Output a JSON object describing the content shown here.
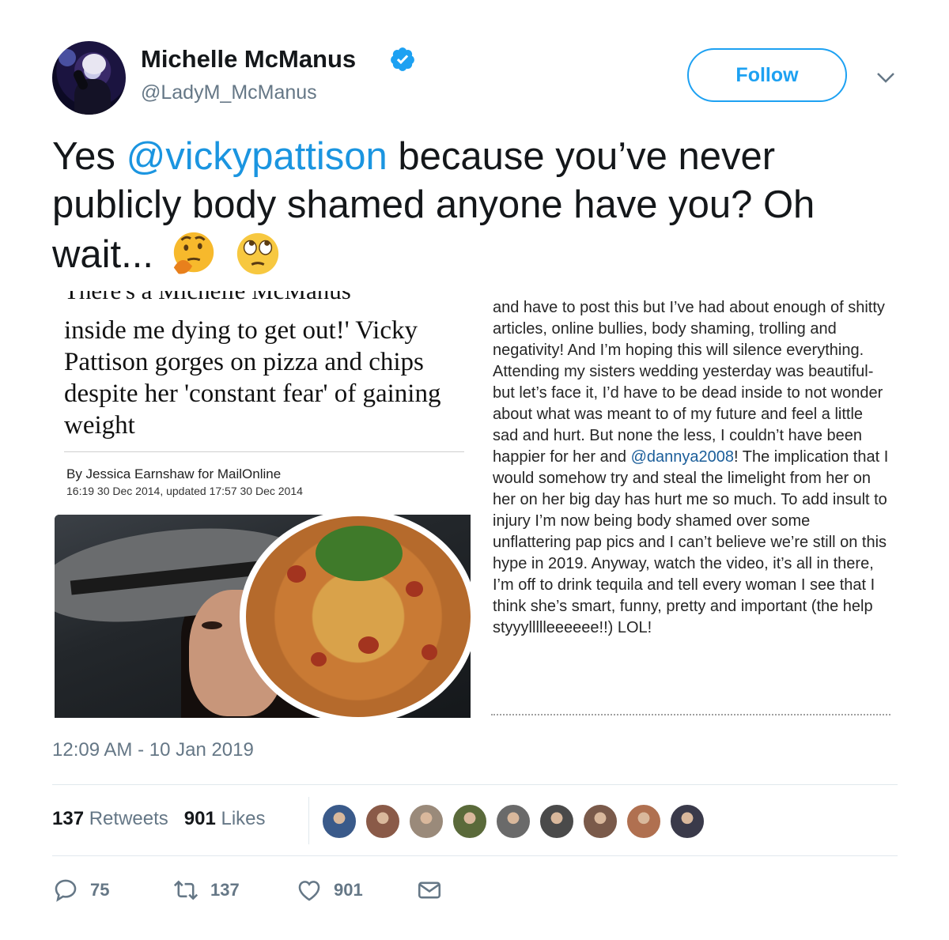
{
  "user": {
    "name": "Michelle McManus",
    "handle": "@LadyM_McManus",
    "verified": true
  },
  "follow_label": "Follow",
  "tweet": {
    "text_start": "Yes ",
    "mention": "@vickypattison",
    "text_rest": " because you’ve never publicly body shamed anyone have you? Oh wait...",
    "emojis": [
      "thinking-face-emoji",
      "face-with-rolling-eyes-emoji"
    ]
  },
  "article": {
    "cut_title": "There's a Michelle McManus",
    "title": "inside me dying to get out!' Vicky Pattison gorges on pizza and chips despite her 'constant fear' of gaining weight",
    "byline": "By Jessica Earnshaw for MailOnline",
    "timeline": "16:19 30 Dec 2014, updated 17:57 30 Dec 2014"
  },
  "caption": {
    "p1": "and have to post this but I’ve had about enough of shitty articles, online bullies, body shaming, trolling and negativity! And I’m hoping this will silence everything.",
    "p2_a": "Attending my sisters wedding yesterday was beautiful- but let’s face it, I’d have to be dead inside to not wonder about what was meant to of my future and feel a little sad and hurt. But none the less, I couldn’t have been happier for her and ",
    "p2_tag": "@dannya2008",
    "p2_b": "! The implication that I would somehow try and steal the limelight from her on her on her big day has hurt me so much. To add insult to injury I’m now being body shamed over some unflattering pap pics and I can’t believe we’re still on this hype in 2019. Anyway, watch the video, it’s all in there, I’m off to drink tequila and tell every woman I see that I think she’s smart, funny, pretty and important (the help styyyllllleeeeee!!) LOL!"
  },
  "timestamp": "12:09 AM - 10 Jan 2019",
  "stats": {
    "retweets_count": "137",
    "retweets_label": "Retweets",
    "likes_count": "901",
    "likes_label": "Likes"
  },
  "likers": [
    {
      "color": "#3a5a8a"
    },
    {
      "color": "#8a5a48"
    },
    {
      "color": "#9a8a7a"
    },
    {
      "color": "#5a6a3a"
    },
    {
      "color": "#6a6a6a"
    },
    {
      "color": "#4a4a4a"
    },
    {
      "color": "#7a5a4a"
    },
    {
      "color": "#b07050"
    },
    {
      "color": "#3a3a4a"
    }
  ],
  "actions": {
    "replies": "75",
    "retweets": "137",
    "likes": "901"
  },
  "colors": {
    "accent": "#1da1f2",
    "mention": "#1b95e0",
    "secondary_text": "#657786"
  }
}
